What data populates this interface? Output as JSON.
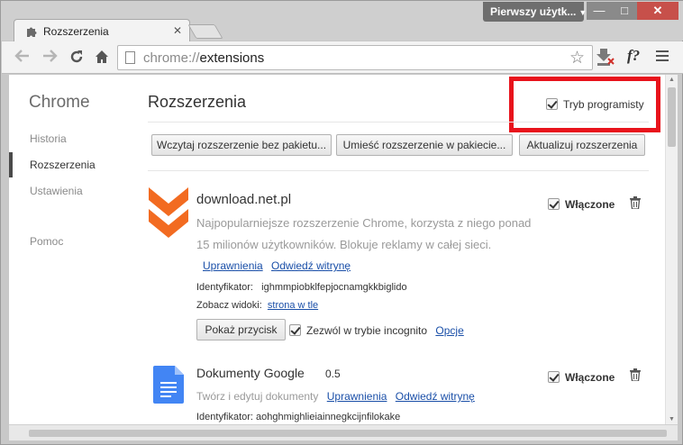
{
  "window": {
    "profile": "Pierwszy użytk...",
    "min": "—",
    "max": "□",
    "close": "✕"
  },
  "tab": {
    "title": "Rozszerzenia",
    "close": "✕"
  },
  "toolbar": {
    "url_scheme": "chrome://",
    "url_path": "extensions",
    "star": "☆",
    "ext_f": "f?"
  },
  "sidebar": {
    "title": "Chrome",
    "items": [
      {
        "label": "Historia"
      },
      {
        "label": "Rozszerzenia"
      },
      {
        "label": "Ustawienia"
      },
      {
        "label": "Pomoc"
      }
    ]
  },
  "main": {
    "title": "Rozszerzenia",
    "dev_mode_label": "Tryb programisty",
    "dev_mode_checked": true,
    "buttons": [
      "Wczytaj rozszerzenie bez pakietu...",
      "Umieść rozszerzenie w pakiecie...",
      "Aktualizuj rozszerzenia"
    ]
  },
  "extensions": [
    {
      "name": "download.net.pl",
      "version": "",
      "description_line1": "Najpopularniejsze rozszerzenie Chrome, korzysta z niego ponad",
      "description_line2": "15 milionów użytkowników. Blokuje reklamy w całej sieci.",
      "link_permissions": "Uprawnienia",
      "link_website": "Odwiedź witrynę",
      "id_label": "Identyfikator:",
      "id_value": "ighmmpiobklfepjocnamgkkbiglido",
      "views_label": "Zobacz widoki:",
      "views_link": "strona w tle",
      "show_button": "Pokaż przycisk",
      "incognito_label": "Zezwól w trybie incognito",
      "options_link": "Opcje",
      "enabled_label": "Włączone",
      "enabled": true,
      "brand_color": "#f26b21"
    },
    {
      "name": "Dokumenty Google",
      "version": "0.5",
      "description": "Twórz i edytuj dokumenty",
      "link_permissions": "Uprawnienia",
      "link_website": "Odwiedź witrynę",
      "id_label": "Identyfikator:",
      "id_value": "aohghmighlieiainnegkcijnfilokake",
      "enabled_label": "Włączone",
      "enabled": true,
      "brand_color": "#4285f4"
    }
  ],
  "colors": {
    "highlight_box": "#e8131c",
    "link": "#1a4fa8"
  }
}
